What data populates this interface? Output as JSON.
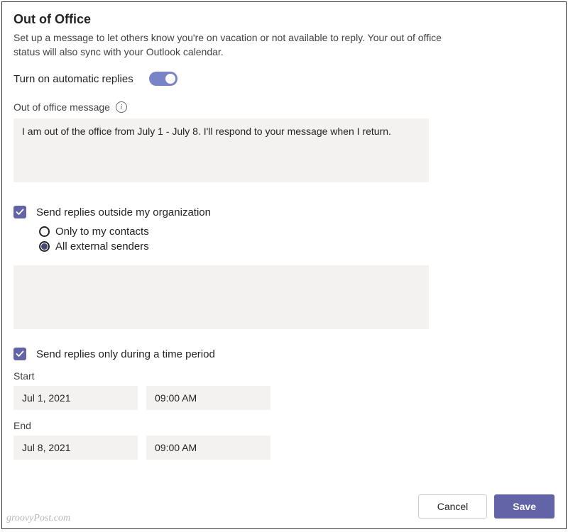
{
  "title": "Out of Office",
  "description": "Set up a message to let others know you're on vacation or not available to reply. Your out of office status will also sync with your Outlook calendar.",
  "auto_replies": {
    "label": "Turn on automatic replies",
    "enabled": true
  },
  "message": {
    "label": "Out of office message",
    "value": "I am out of the office from July 1 - July 8. I'll respond to your message when I return."
  },
  "external": {
    "label": "Send replies outside my organization",
    "checked": true,
    "options": {
      "contacts": "Only to my contacts",
      "all": "All external senders"
    },
    "selected": "all",
    "message": ""
  },
  "time_period": {
    "label": "Send replies only during a time period",
    "checked": true,
    "start_label": "Start",
    "start_date": "Jul 1, 2021",
    "start_time": "09:00 AM",
    "end_label": "End",
    "end_date": "Jul 8, 2021",
    "end_time": "09:00 AM"
  },
  "buttons": {
    "cancel": "Cancel",
    "save": "Save"
  },
  "watermark": "groovyPost.com"
}
